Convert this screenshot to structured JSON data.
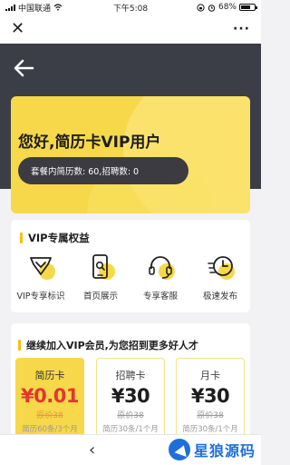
{
  "status_bar": {
    "carrier": "中国联通",
    "time": "下午5:08",
    "battery": "68%"
  },
  "nav": {
    "close_icon": "close-icon",
    "more": "···"
  },
  "vip_card": {
    "title": "您好,简历卡VIP用户",
    "package_info": "套餐内简历数: 60,招聘数: 0"
  },
  "benefits": {
    "title": "VIP专属权益",
    "items": [
      {
        "label": "VIP专享标识",
        "icon": "diamond-badge-icon"
      },
      {
        "label": "首页展示",
        "icon": "phone-search-icon"
      },
      {
        "label": "专享客服",
        "icon": "headset-icon"
      },
      {
        "label": "极速发布",
        "icon": "fast-clock-icon"
      }
    ]
  },
  "plans": {
    "title": "继续加入VIP会员,为您招到更多好人才",
    "items": [
      {
        "name": "简历卡",
        "price": "¥0.01",
        "original": "原价38",
        "detail": "简历60条/3个月"
      },
      {
        "name": "招聘卡",
        "price": "¥30",
        "original": "原价38",
        "detail": "简历30条/1个月"
      },
      {
        "name": "月卡",
        "price": "¥30",
        "original": "原价38",
        "detail": "简历30条/1个月"
      }
    ]
  },
  "bottom": {
    "back": "‹",
    "watermark": "星狼源码"
  },
  "colors": {
    "accent_yellow": "#f7d84a",
    "dark_header": "#3b3d47",
    "price_red": "#e4362f"
  }
}
